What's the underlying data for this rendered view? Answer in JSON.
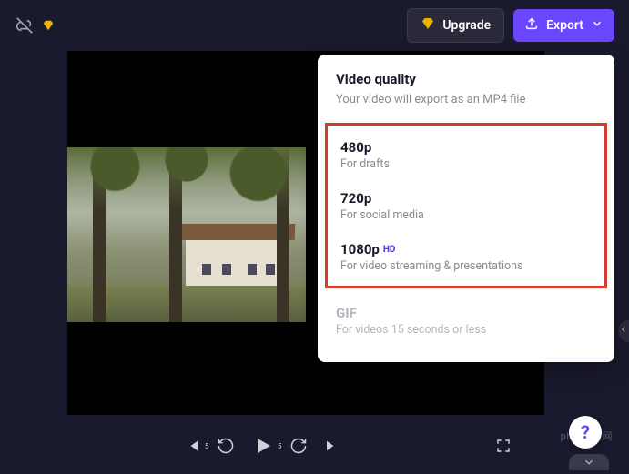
{
  "topbar": {
    "upgrade_label": "Upgrade",
    "export_label": "Export"
  },
  "dropdown": {
    "title": "Video quality",
    "subtitle": "Your video will export as an MP4 file",
    "options": [
      {
        "title": "480p",
        "subtitle": "For drafts",
        "hd": false
      },
      {
        "title": "720p",
        "subtitle": "For social media",
        "hd": false
      },
      {
        "title": "1080p",
        "subtitle": "For video streaming & presentations",
        "hd": true
      }
    ],
    "hd_badge": "HD",
    "gif": {
      "title": "GIF",
      "subtitle": "For videos 15 seconds or less"
    }
  },
  "help_label": "?",
  "watermark": "php 中文网"
}
